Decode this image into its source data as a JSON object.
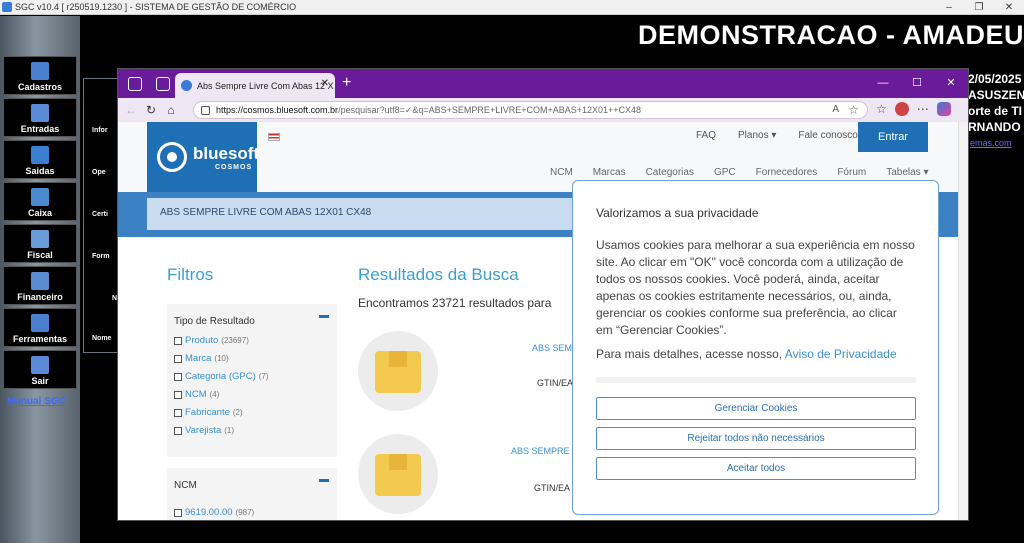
{
  "app": {
    "title": "SGC v10.4 [ r250519.1230 ] - SISTEMA DE GESTÃO DE COMÉRCIO",
    "banner": "DEMONSTRACAO - AMADEU"
  },
  "sidebar": {
    "items": [
      {
        "label": "Cadastros"
      },
      {
        "label": "Entradas"
      },
      {
        "label": "Saidas"
      },
      {
        "label": "Caixa"
      },
      {
        "label": "Fiscal"
      },
      {
        "label": "Financeiro"
      },
      {
        "label": "Ferramentas"
      },
      {
        "label": "Sair"
      }
    ],
    "manual": "Manual SGC"
  },
  "inner": {
    "items": [
      "Infor",
      "Ope",
      "Certi",
      "Form",
      "N",
      "Nome"
    ]
  },
  "right": {
    "lines": [
      "2/05/2025",
      "ASUSZEN",
      "orte de TI",
      "RNANDO"
    ],
    "link": "emas.com"
  },
  "browser": {
    "tab_title": "Abs Sempre Livre Com Abas 12 X",
    "url_host": "https://cosmos.bluesoft.com.br",
    "url_path": "/pesquisar?utf8=✓&q=ABS+SEMPRE+LIVRE+COM+ABAS+12X01++CX48",
    "page": {
      "logo_name": "bluesoft",
      "logo_sub": "COSMOS",
      "top_links": [
        "FAQ",
        "Planos ▾",
        "Fale conosco"
      ],
      "enter": "Entrar",
      "menu": [
        "NCM",
        "Marcas",
        "Categorias",
        "GPC",
        "Fornecedores",
        "Fórum",
        "Tabelas ▾"
      ],
      "search_value": "ABS SEMPRE LIVRE COM ABAS 12X01  CX48",
      "filters_title": "Filtros",
      "filter_groups": [
        {
          "title": "Tipo de Resultado",
          "items": [
            {
              "label": "Produto",
              "count": "(23697)"
            },
            {
              "label": "Marca",
              "count": "(10)"
            },
            {
              "label": "Categoria (GPC)",
              "count": "(7)"
            },
            {
              "label": "NCM",
              "count": "(4)"
            },
            {
              "label": "Fabricante",
              "count": "(2)"
            },
            {
              "label": "Varejista",
              "count": "(1)"
            }
          ]
        },
        {
          "title": "NCM",
          "items": [
            {
              "label": "9619.00.00",
              "count": "(987)"
            }
          ]
        }
      ],
      "results_title": "Resultados da Busca",
      "results_sub": "Encontramos 23721 resultados para",
      "results": [
        {
          "name": "ABS SEMP",
          "gtin": "GTIN/EA"
        },
        {
          "name": "ABS SEMPRE L",
          "gtin": "GTIN/EA"
        }
      ]
    }
  },
  "consent": {
    "title": "Valorizamos a sua privacidade",
    "body": "Usamos cookies para melhorar a sua experiência em nosso site. Ao clicar em \"OK\" você concorda com a utilização de todos os nossos cookies. Você poderá, ainda, aceitar apenas os cookies estritamente necessários, ou, ainda, gerenciar os cookies conforme sua preferência, ao clicar em “Gerenciar Cookies”.",
    "more": "Para mais detalhes, acesse nosso,",
    "more_link": "Aviso de Privacidade",
    "buttons": [
      "Gerenciar Cookies",
      "Rejeitar todos não necessários",
      "Aceitar todos"
    ]
  }
}
